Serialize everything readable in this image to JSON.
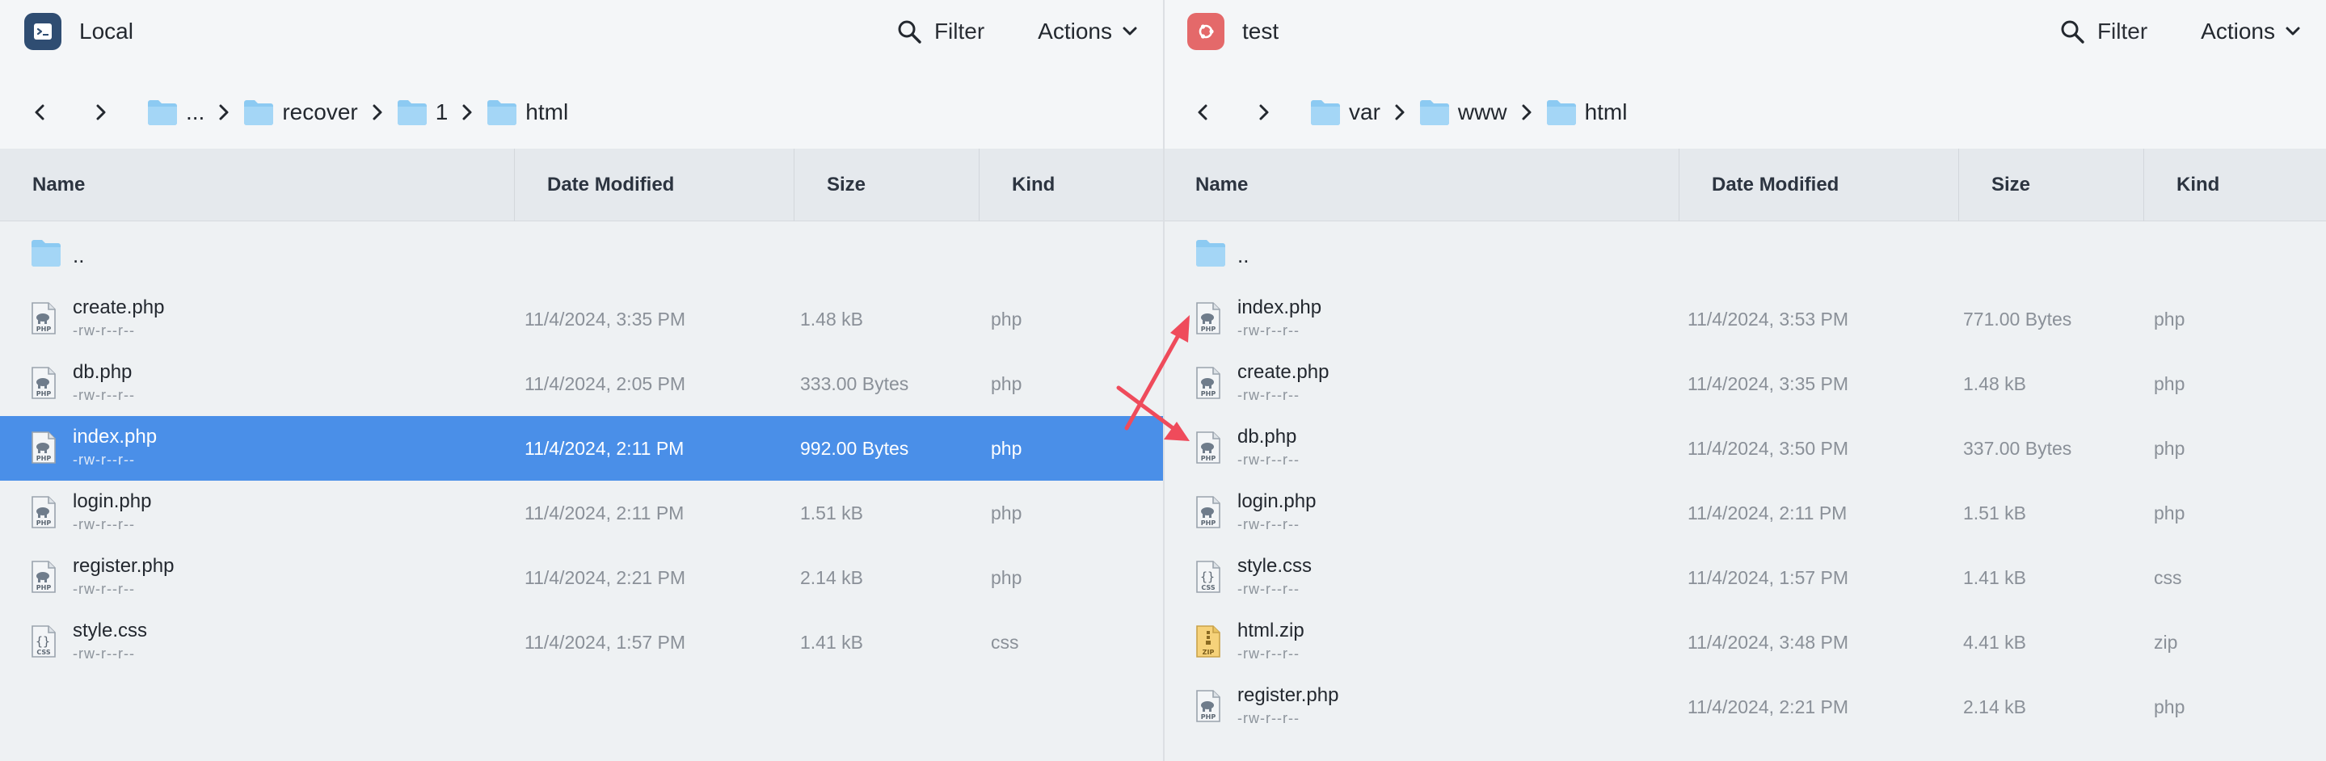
{
  "left": {
    "connection_name": "Local",
    "connection_icon": "terminal-app-icon",
    "filter_label": "Filter",
    "actions_label": "Actions",
    "breadcrumbs": [
      "...",
      "recover",
      "1",
      "html"
    ],
    "columns": {
      "name": "Name",
      "date": "Date Modified",
      "size": "Size",
      "kind": "Kind"
    },
    "parent_label": "..",
    "files": [
      {
        "name": "create.php",
        "perm": "-rw-r--r--",
        "date": "11/4/2024, 3:35 PM",
        "size": "1.48 kB",
        "kind": "php",
        "icon": "php-file-icon",
        "selected": false
      },
      {
        "name": "db.php",
        "perm": "-rw-r--r--",
        "date": "11/4/2024, 2:05 PM",
        "size": "333.00 Bytes",
        "kind": "php",
        "icon": "php-file-icon",
        "selected": false
      },
      {
        "name": "index.php",
        "perm": "-rw-r--r--",
        "date": "11/4/2024, 2:11 PM",
        "size": "992.00 Bytes",
        "kind": "php",
        "icon": "php-file-icon",
        "selected": true
      },
      {
        "name": "login.php",
        "perm": "-rw-r--r--",
        "date": "11/4/2024, 2:11 PM",
        "size": "1.51 kB",
        "kind": "php",
        "icon": "php-file-icon",
        "selected": false
      },
      {
        "name": "register.php",
        "perm": "-rw-r--r--",
        "date": "11/4/2024, 2:21 PM",
        "size": "2.14 kB",
        "kind": "php",
        "icon": "php-file-icon",
        "selected": false
      },
      {
        "name": "style.css",
        "perm": "-rw-r--r--",
        "date": "11/4/2024, 1:57 PM",
        "size": "1.41 kB",
        "kind": "css",
        "icon": "css-file-icon",
        "selected": false
      }
    ]
  },
  "right": {
    "connection_name": "test",
    "connection_icon": "ubuntu-server-icon",
    "filter_label": "Filter",
    "actions_label": "Actions",
    "breadcrumbs": [
      "var",
      "www",
      "html"
    ],
    "columns": {
      "name": "Name",
      "date": "Date Modified",
      "size": "Size",
      "kind": "Kind"
    },
    "parent_label": "..",
    "files": [
      {
        "name": "index.php",
        "perm": "-rw-r--r--",
        "date": "11/4/2024, 3:53 PM",
        "size": "771.00 Bytes",
        "kind": "php",
        "icon": "php-file-icon",
        "selected": false
      },
      {
        "name": "create.php",
        "perm": "-rw-r--r--",
        "date": "11/4/2024, 3:35 PM",
        "size": "1.48 kB",
        "kind": "php",
        "icon": "php-file-icon",
        "selected": false
      },
      {
        "name": "db.php",
        "perm": "-rw-r--r--",
        "date": "11/4/2024, 3:50 PM",
        "size": "337.00 Bytes",
        "kind": "php",
        "icon": "php-file-icon",
        "selected": false
      },
      {
        "name": "login.php",
        "perm": "-rw-r--r--",
        "date": "11/4/2024, 2:11 PM",
        "size": "1.51 kB",
        "kind": "php",
        "icon": "php-file-icon",
        "selected": false
      },
      {
        "name": "style.css",
        "perm": "-rw-r--r--",
        "date": "11/4/2024, 1:57 PM",
        "size": "1.41 kB",
        "kind": "css",
        "icon": "css-file-icon",
        "selected": false
      },
      {
        "name": "html.zip",
        "perm": "-rw-r--r--",
        "date": "11/4/2024, 3:48 PM",
        "size": "4.41 kB",
        "kind": "zip",
        "icon": "zip-file-icon",
        "selected": false
      },
      {
        "name": "register.php",
        "perm": "-rw-r--r--",
        "date": "11/4/2024, 2:21 PM",
        "size": "2.14 kB",
        "kind": "php",
        "icon": "php-file-icon",
        "selected": false
      }
    ]
  },
  "colors": {
    "selection": "#4a8fe8",
    "annotation_arrow": "#ef4b5b",
    "local_icon_bg": "#2f4d72",
    "test_icon_bg": "#e4696a",
    "folder": "#8ccaf2"
  }
}
